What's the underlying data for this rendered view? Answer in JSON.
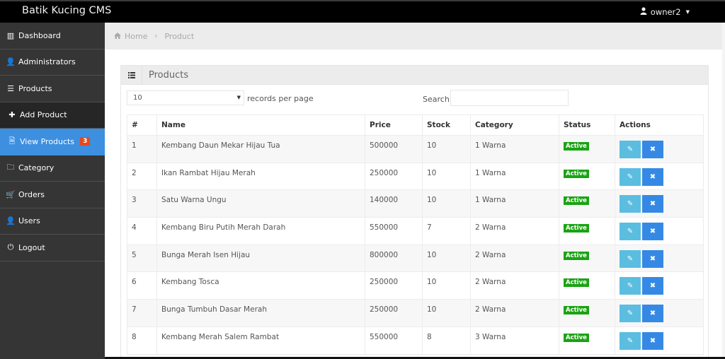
{
  "header": {
    "brand": "Batik Kucing CMS",
    "user": "owner2",
    "user_icon": "user-icon",
    "caret_icon": "caret-down-icon"
  },
  "sidebar": {
    "items": [
      {
        "label": "Dashboard",
        "icon": "bar-chart-icon",
        "glyph": "▥"
      },
      {
        "label": "Administrators",
        "icon": "user-icon",
        "glyph": "👤"
      },
      {
        "label": "Products",
        "icon": "list-icon",
        "glyph": "☰"
      },
      {
        "label": "Add Product",
        "icon": "plus-icon",
        "glyph": "✚"
      },
      {
        "label": "View Products",
        "icon": "file-icon",
        "glyph": "🗎",
        "badge": "3"
      },
      {
        "label": "Category",
        "icon": "folder-icon",
        "glyph": "🗀"
      },
      {
        "label": "Orders",
        "icon": "cart-icon",
        "glyph": "🛒"
      },
      {
        "label": "Users",
        "icon": "user-icon",
        "glyph": "👤"
      },
      {
        "label": "Logout",
        "icon": "power-icon",
        "glyph": "⏻"
      }
    ]
  },
  "breadcrumb": {
    "home": "Home",
    "separator": "›",
    "current": "Product"
  },
  "panel": {
    "title": "Products",
    "records_per_page_value": "10",
    "records_per_page_label": "records per page",
    "search_label": "Search:",
    "search_value": ""
  },
  "table": {
    "columns": [
      "#",
      "Name",
      "Price",
      "Stock",
      "Category",
      "Status",
      "Actions"
    ],
    "rows": [
      {
        "no": "1",
        "name": "Kembang Daun Mekar Hijau Tua",
        "price": "500000",
        "stock": "10",
        "category": "1 Warna",
        "status": "Active"
      },
      {
        "no": "2",
        "name": "Ikan Rambat Hijau Merah",
        "price": "250000",
        "stock": "10",
        "category": "1 Warna",
        "status": "Active"
      },
      {
        "no": "3",
        "name": "Satu Warna Ungu",
        "price": "140000",
        "stock": "10",
        "category": "1 Warna",
        "status": "Active"
      },
      {
        "no": "4",
        "name": "Kembang Biru Putih Merah Darah",
        "price": "550000",
        "stock": "7",
        "category": "2 Warna",
        "status": "Active"
      },
      {
        "no": "5",
        "name": "Bunga Merah Isen Hijau",
        "price": "800000",
        "stock": "10",
        "category": "2 Warna",
        "status": "Active"
      },
      {
        "no": "6",
        "name": "Kembang Tosca",
        "price": "250000",
        "stock": "10",
        "category": "2 Warna",
        "status": "Active"
      },
      {
        "no": "7",
        "name": "Bunga Tumbuh Dasar Merah",
        "price": "250000",
        "stock": "10",
        "category": "2 Warna",
        "status": "Active"
      },
      {
        "no": "8",
        "name": "Kembang Merah Salem Rambat",
        "price": "550000",
        "stock": "8",
        "category": "3 Warna",
        "status": "Active"
      }
    ],
    "edit_glyph": "✎",
    "delete_glyph": "✖"
  },
  "colors": {
    "topbar": "#000000",
    "sidebar": "#353535",
    "sidebar_active": "#3d8fe0",
    "badge": "#e8491d",
    "status_active": "#1aa313",
    "edit_button": "#5bbde0",
    "delete_button": "#3589e5"
  }
}
